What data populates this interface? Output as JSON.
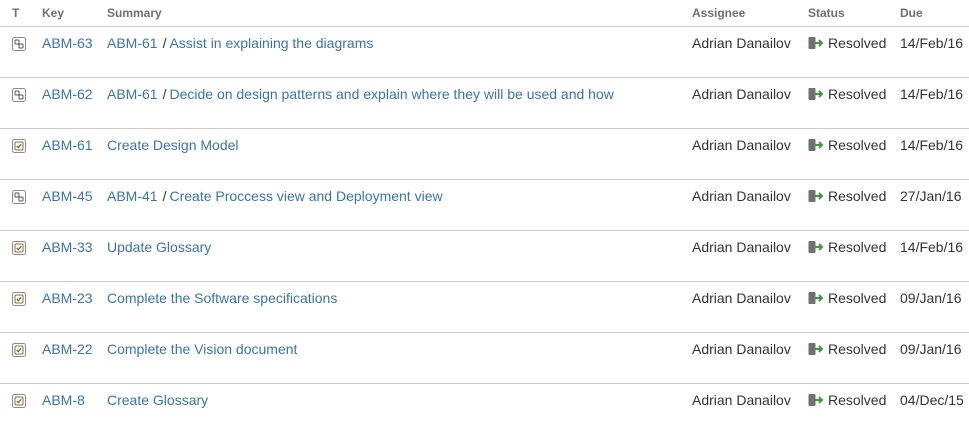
{
  "columns": {
    "type": "T",
    "key": "Key",
    "summary": "Summary",
    "assignee": "Assignee",
    "status": "Status",
    "due": "Due"
  },
  "colors": {
    "link": "#3b73af",
    "text": "#333333",
    "header": "#707070",
    "border": "#cccccc",
    "resolved_arrow": "#3c9a3c"
  },
  "rows": [
    {
      "icon": "subtask-icon",
      "key": "ABM-63",
      "parent": "ABM-61",
      "summary": "Assist in explaining the diagrams",
      "assignee": "Adrian Danailov",
      "status": "Resolved",
      "due": "14/Feb/16"
    },
    {
      "icon": "subtask-icon",
      "key": "ABM-62",
      "parent": "ABM-61",
      "summary": "Decide on design patterns and explain where they will be used and how",
      "assignee": "Adrian Danailov",
      "status": "Resolved",
      "due": "14/Feb/16"
    },
    {
      "icon": "task-icon",
      "key": "ABM-61",
      "parent": "",
      "summary": "Create Design Model",
      "assignee": "Adrian Danailov",
      "status": "Resolved",
      "due": "14/Feb/16"
    },
    {
      "icon": "subtask-icon",
      "key": "ABM-45",
      "parent": "ABM-41",
      "summary": "Create Proccess view and Deployment view",
      "assignee": "Adrian Danailov",
      "status": "Resolved",
      "due": "27/Jan/16"
    },
    {
      "icon": "task-icon",
      "key": "ABM-33",
      "parent": "",
      "summary": "Update Glossary",
      "assignee": "Adrian Danailov",
      "status": "Resolved",
      "due": "14/Feb/16"
    },
    {
      "icon": "task-icon",
      "key": "ABM-23",
      "parent": "",
      "summary": "Complete the Software specifications",
      "assignee": "Adrian Danailov",
      "status": "Resolved",
      "due": "09/Jan/16"
    },
    {
      "icon": "task-icon",
      "key": "ABM-22",
      "parent": "",
      "summary": "Complete the Vision document",
      "assignee": "Adrian Danailov",
      "status": "Resolved",
      "due": "09/Jan/16"
    },
    {
      "icon": "task-icon",
      "key": "ABM-8",
      "parent": "",
      "summary": "Create Glossary",
      "assignee": "Adrian Danailov",
      "status": "Resolved",
      "due": "04/Dec/15"
    }
  ]
}
